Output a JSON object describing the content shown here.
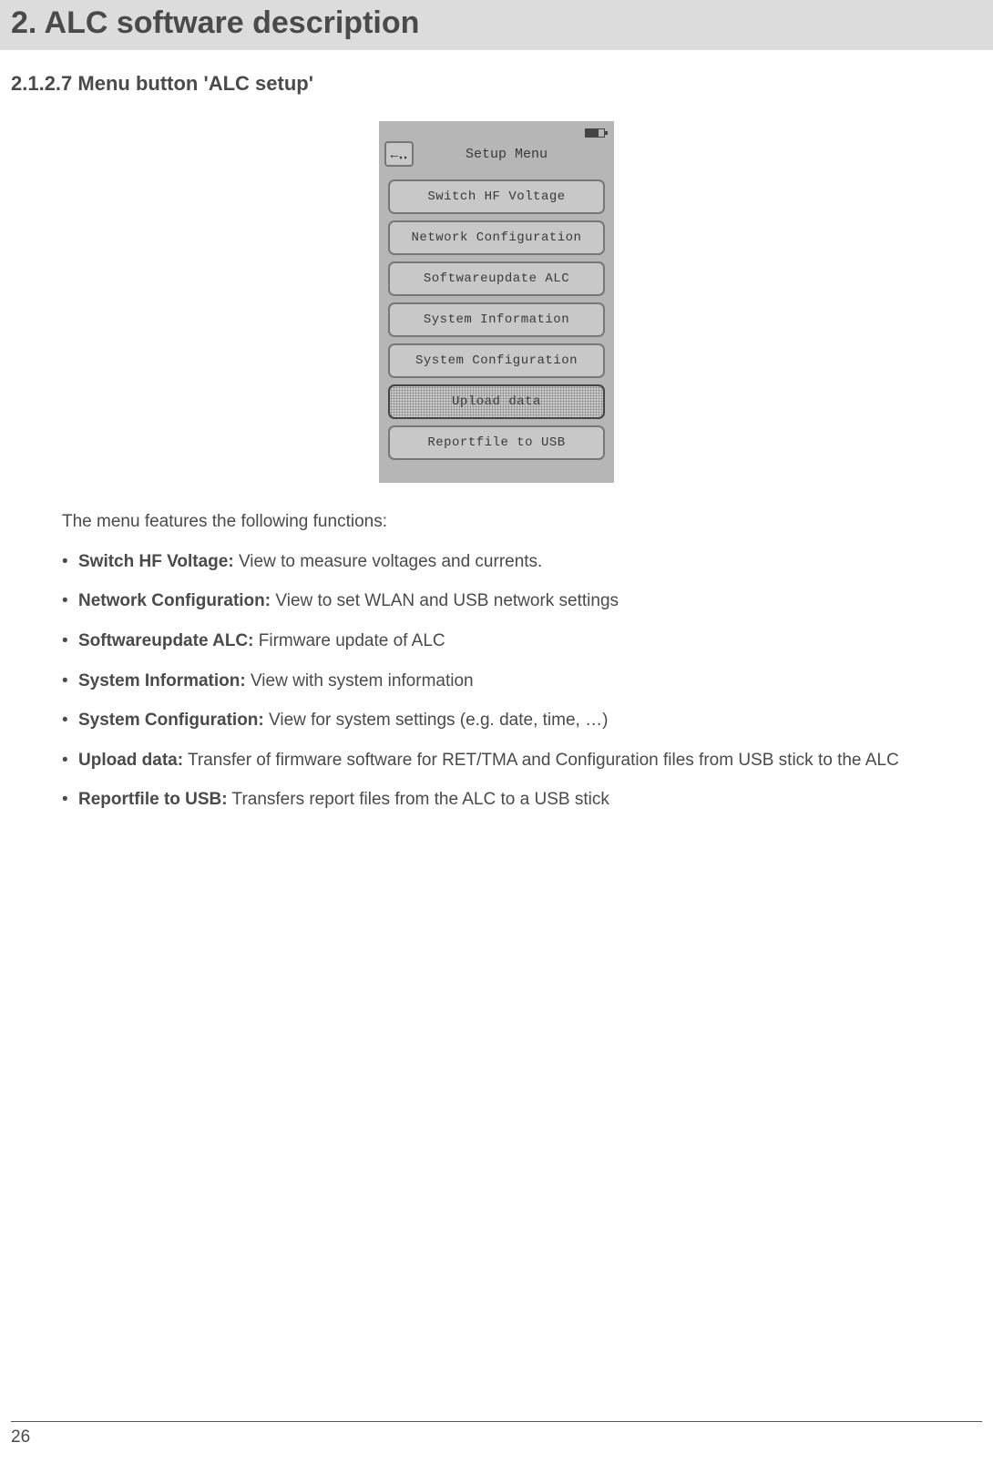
{
  "header": {
    "title": "2. ALC software description"
  },
  "section": {
    "title": "2.1.2.7 Menu button 'ALC setup'"
  },
  "device": {
    "back_label": "←‥",
    "menu_title": "Setup Menu",
    "items": [
      {
        "label": "Switch HF Voltage",
        "selected": false
      },
      {
        "label": "Network Configuration",
        "selected": false
      },
      {
        "label": "Softwareupdate ALC",
        "selected": false
      },
      {
        "label": "System Information",
        "selected": false
      },
      {
        "label": "System Configuration",
        "selected": false
      },
      {
        "label": "Upload data",
        "selected": true
      },
      {
        "label": "Reportfile to USB",
        "selected": false
      }
    ]
  },
  "body": {
    "intro": "The menu features the following functions:",
    "bullets": [
      {
        "term": "Switch HF Voltage:",
        "desc": " View to measure voltages and currents."
      },
      {
        "term": "Network Configuration:",
        "desc": " View to set WLAN and USB network settings"
      },
      {
        "term": "Softwareupdate ALC:",
        "desc": " Firmware update of ALC"
      },
      {
        "term": "System Information:",
        "desc": " View with system information"
      },
      {
        "term": "System Configuration:",
        "desc": " View for system settings (e.g. date, time, …)"
      },
      {
        "term": "Upload data:",
        "desc": " Transfer of firmware software for RET/TMA and Configuration files from USB stick to the ALC"
      },
      {
        "term": "Reportfile to USB:",
        "desc": " Transfers report files from the ALC to a USB stick"
      }
    ]
  },
  "footer": {
    "page_number": "26"
  }
}
